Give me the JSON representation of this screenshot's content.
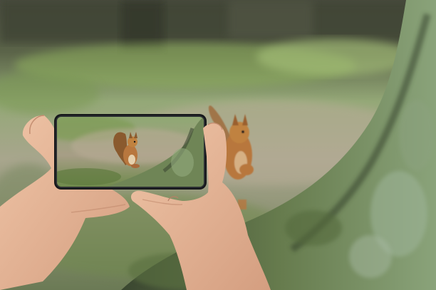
{
  "photo": {
    "subject": "hands-holding-smartphone-photographing-squirrel",
    "colors": {
      "backdrop_dark": "#3f4435",
      "lawn": "#9fb27a",
      "path_dirt": "#b9ad98",
      "bark_moss": "#6f8556",
      "bark_shadow": "#3d4a33",
      "squirrel_fur": "#b8773e",
      "skin": "#e7b799",
      "phone_frame": "#15171a"
    }
  }
}
